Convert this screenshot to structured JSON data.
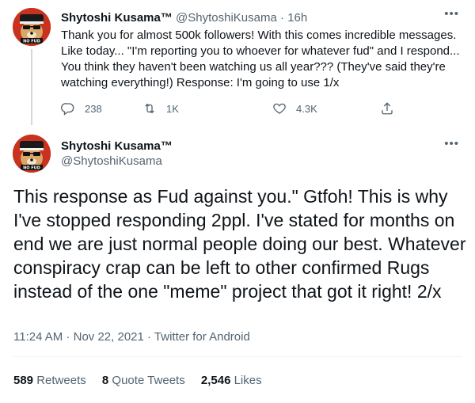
{
  "parent_tweet": {
    "display_name": "Shytoshi Kusama™",
    "handle": "@ShytoshiKusama",
    "separator": "·",
    "time": "16h",
    "more": "•••",
    "text": "Thank you for almost 500k followers! With this comes incredible messages. Like today... \"I'm reporting you to whoever for whatever fud\" and I respond... You think they haven't been watching us all year??? (They've said they're watching everything!) Response: I'm going to use 1/x",
    "avatar_badge": "NO FUD",
    "actions": {
      "replies": "238",
      "retweets": "1K",
      "likes": "4.3K"
    }
  },
  "main_tweet": {
    "display_name": "Shytoshi Kusama™",
    "handle": "@ShytoshiKusama",
    "more": "•••",
    "avatar_badge": "NO FUD",
    "text": "This response as Fud against you.\" Gtfoh! This is why I've stopped responding 2ppl. I've stated for months on end we are just normal people doing our best. Whatever conspiracy crap can be left to other confirmed Rugs instead of the one \"meme\" project that got it right! 2/x",
    "time": "11:24 AM",
    "separator": "·",
    "date": "Nov 22, 2021",
    "source": "Twitter for Android",
    "stats": {
      "retweets_count": "589",
      "retweets_label": "Retweets",
      "quotes_count": "8",
      "quotes_label": "Quote Tweets",
      "likes_count": "2,546",
      "likes_label": "Likes"
    }
  },
  "colors": {
    "text_primary": "#0f1419",
    "text_secondary": "#536471",
    "thread_line": "#cfd9de",
    "divider": "#eff3f4",
    "avatar_bg": "#c8321f"
  },
  "icons": [
    "reply-icon",
    "retweet-icon",
    "like-icon",
    "share-icon",
    "more-icon"
  ]
}
